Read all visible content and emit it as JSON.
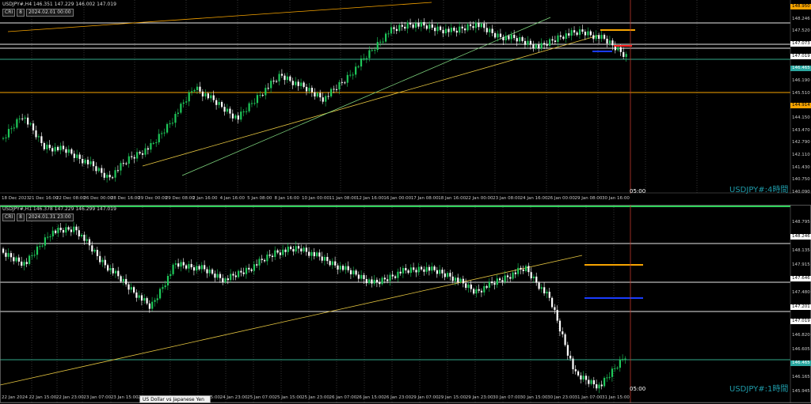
{
  "top": {
    "header": "USDJPY#,H4  146.351 147.229 146.002 147.019",
    "ctrl_label": "CRI",
    "ctrl_value": "8",
    "datetime": "2024.02.01 00:00",
    "watermark": "USDJPY#:4時間",
    "time_label": "05:00",
    "price_axis": [
      {
        "text": "148.950",
        "style": "orange"
      },
      {
        "text": "148.246",
        "style": "plain"
      },
      {
        "text": "147.520",
        "style": "plain"
      },
      {
        "text": "147.073",
        "style": "white"
      },
      {
        "text": "147.019",
        "style": "white"
      },
      {
        "text": "146.465",
        "style": "green"
      },
      {
        "text": "146.190",
        "style": "plain"
      },
      {
        "text": "145.510",
        "style": "plain"
      },
      {
        "text": "144.914",
        "style": "orange"
      },
      {
        "text": "144.150",
        "style": "plain"
      },
      {
        "text": "143.470",
        "style": "plain"
      },
      {
        "text": "142.790",
        "style": "plain"
      },
      {
        "text": "142.110",
        "style": "plain"
      },
      {
        "text": "141.430",
        "style": "plain"
      },
      {
        "text": "140.750",
        "style": "plain"
      },
      {
        "text": "140.090",
        "style": "plain"
      }
    ],
    "time_axis": [
      "18 Dec 2023",
      "21 Dec 16:00",
      "22 Dec 08:00",
      "26 Dec 00:00",
      "28 Dec 16:00",
      "29 Dec 00:00",
      "29 Dec 08:00",
      "2 Jan 16:00",
      "4 Jan 16:00",
      "5 Jan 08:00",
      "8 Jan 16:00",
      "10 Jan 00:00",
      "11 Jan 08:00",
      "12 Jan 16:00",
      "16 Jan 00:00",
      "17 Jan 08:00",
      "18 Jan 16:00",
      "22 Jan 00:00",
      "23 Jan 08:00",
      "24 Jan 16:00",
      "26 Jan 00:00",
      "29 Jan 08:00",
      "30 Jan 16:00"
    ]
  },
  "bottom": {
    "header": "USDJPY#,H1  146.378 147.229 146.299 147.019",
    "ctrl_label": "CRI",
    "ctrl_value": "8",
    "datetime": "2024.01.31 23:00",
    "watermark": "USDJPY#:1時間",
    "time_label": "05:00",
    "price_axis": [
      {
        "text": "148.795",
        "style": "plain"
      },
      {
        "text": "148.246",
        "style": "white"
      },
      {
        "text": "148.135",
        "style": "plain"
      },
      {
        "text": "147.915",
        "style": "plain"
      },
      {
        "text": "147.646",
        "style": "white"
      },
      {
        "text": "147.480",
        "style": "plain"
      },
      {
        "text": "147.201",
        "style": "white"
      },
      {
        "text": "147.019",
        "style": "white"
      },
      {
        "text": "146.820",
        "style": "plain"
      },
      {
        "text": "146.605",
        "style": "plain"
      },
      {
        "text": "146.465",
        "style": "green"
      },
      {
        "text": "146.165",
        "style": "plain"
      },
      {
        "text": "145.945",
        "style": "plain"
      }
    ],
    "time_axis": [
      "22 Jan 2024",
      "22 Jan 15:00",
      "22 Jan 23:00",
      "23 Jan 07:00",
      "23 Jan 15:00",
      "23 Jan 23:00",
      "24 Jan 07:00",
      "24 Jan 15:00",
      "24 Jan 23:00",
      "25 Jan 07:00",
      "25 Jan 15:00",
      "25 Jan 23:00",
      "26 Jan 07:00",
      "26 Jan 15:00",
      "26 Jan 23:00",
      "29 Jan 07:00",
      "29 Jan 15:00",
      "29 Jan 23:00",
      "30 Jan 07:00",
      "30 Jan 15:00",
      "30 Jan 23:00",
      "31 Jan 07:00",
      "31 Jan 15:00"
    ]
  },
  "tooltip": "US Dollar vs Japanese Yen",
  "colors": {
    "bull": "#1ec95a",
    "bear": "#ffffff",
    "hline": "#e8e8e8",
    "green_line": "#34a88a",
    "orange_line": "#f7a400",
    "trend_yellow": "#e6c640",
    "trend_green": "#7fd67f",
    "red_marker": "#ff2020",
    "blue_marker": "#1a3cff",
    "cursor": "#c0392b"
  }
}
